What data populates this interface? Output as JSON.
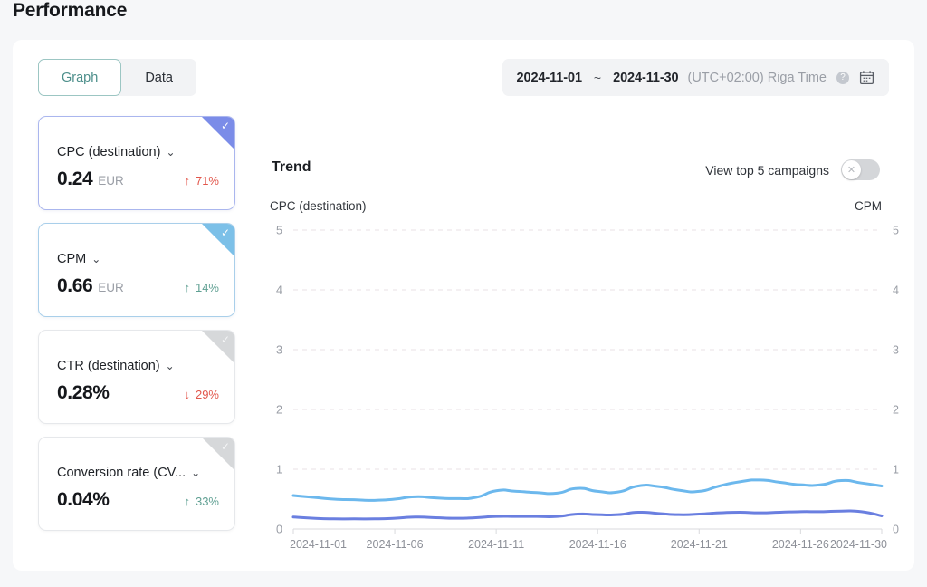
{
  "page_title": "Performance",
  "toolbar": {
    "tabs": [
      {
        "label": "Graph",
        "active": true
      },
      {
        "label": "Data",
        "active": false
      }
    ],
    "date_range": {
      "start": "2024-11-01",
      "separator": "~",
      "end": "2024-11-30",
      "timezone": "(UTC+02:00) Riga Time",
      "help_icon": "question-mark-icon",
      "calendar_icon": "calendar-icon"
    }
  },
  "metric_cards": [
    {
      "name": "CPC (destination)",
      "value": "0.24",
      "unit": "EUR",
      "delta_arrow": "↑",
      "delta": "71%",
      "delta_tone": "up-red",
      "selected": true,
      "accent": "#7b8ce8",
      "check_icon": "check-icon",
      "chevron_icon": "chevron-down-icon"
    },
    {
      "name": "CPM",
      "value": "0.66",
      "unit": "EUR",
      "delta_arrow": "↑",
      "delta": "14%",
      "delta_tone": "up-green",
      "selected": true,
      "accent": "#7cc0e8",
      "check_icon": "check-icon",
      "chevron_icon": "chevron-down-icon"
    },
    {
      "name": "CTR (destination)",
      "value": "0.28%",
      "unit": "",
      "delta_arrow": "↓",
      "delta": "29%",
      "delta_tone": "down-red",
      "selected": false,
      "accent": "#d6d8da",
      "check_icon": "check-icon",
      "chevron_icon": "chevron-down-icon"
    },
    {
      "name": "Conversion rate (CV...",
      "value": "0.04%",
      "unit": "",
      "delta_arrow": "↑",
      "delta": "33%",
      "delta_tone": "up-green",
      "selected": false,
      "accent": "#d6d8da",
      "check_icon": "check-icon",
      "chevron_icon": "chevron-down-icon"
    }
  ],
  "chart_panel": {
    "title": "Trend",
    "toggle_label": "View top 5 campaigns",
    "toggle_on": false,
    "toggle_knob_icon": "close-x-icon"
  },
  "chart_data": {
    "type": "line",
    "title": "Trend",
    "xlabel": "",
    "ylabel": "CPC (destination)",
    "y2label": "CPM",
    "ylim": [
      0,
      5
    ],
    "y2lim": [
      0,
      5
    ],
    "yticks": [
      "0",
      "1",
      "2",
      "3",
      "4",
      "5"
    ],
    "y2ticks": [
      "0",
      "1",
      "2",
      "3",
      "4",
      "5"
    ],
    "grid": true,
    "legend": "none",
    "x": [
      "2024-11-01",
      "2024-11-02",
      "2024-11-03",
      "2024-11-04",
      "2024-11-05",
      "2024-11-06",
      "2024-11-07",
      "2024-11-08",
      "2024-11-09",
      "2024-11-10",
      "2024-11-11",
      "2024-11-12",
      "2024-11-13",
      "2024-11-14",
      "2024-11-15",
      "2024-11-16",
      "2024-11-17",
      "2024-11-18",
      "2024-11-19",
      "2024-11-20",
      "2024-11-21",
      "2024-11-22",
      "2024-11-23",
      "2024-11-24",
      "2024-11-25",
      "2024-11-26",
      "2024-11-27",
      "2024-11-28",
      "2024-11-29",
      "2024-11-30"
    ],
    "xticks": [
      "2024-11-01",
      "2024-11-06",
      "2024-11-11",
      "2024-11-16",
      "2024-11-21",
      "2024-11-26",
      "2024-11-30"
    ],
    "series": [
      {
        "name": "CPM",
        "color": "#6cb8ed",
        "axis": "right",
        "values": [
          0.56,
          0.53,
          0.5,
          0.49,
          0.48,
          0.5,
          0.54,
          0.52,
          0.51,
          0.53,
          0.64,
          0.63,
          0.61,
          0.6,
          0.68,
          0.63,
          0.62,
          0.72,
          0.71,
          0.65,
          0.63,
          0.72,
          0.79,
          0.82,
          0.78,
          0.74,
          0.74,
          0.81,
          0.77,
          0.72
        ]
      },
      {
        "name": "CPC (destination)",
        "color": "#6a7fe0",
        "axis": "left",
        "values": [
          0.2,
          0.18,
          0.17,
          0.17,
          0.17,
          0.18,
          0.2,
          0.19,
          0.18,
          0.19,
          0.21,
          0.21,
          0.21,
          0.21,
          0.25,
          0.24,
          0.24,
          0.28,
          0.26,
          0.24,
          0.25,
          0.27,
          0.28,
          0.27,
          0.28,
          0.29,
          0.29,
          0.3,
          0.29,
          0.22
        ]
      }
    ]
  }
}
